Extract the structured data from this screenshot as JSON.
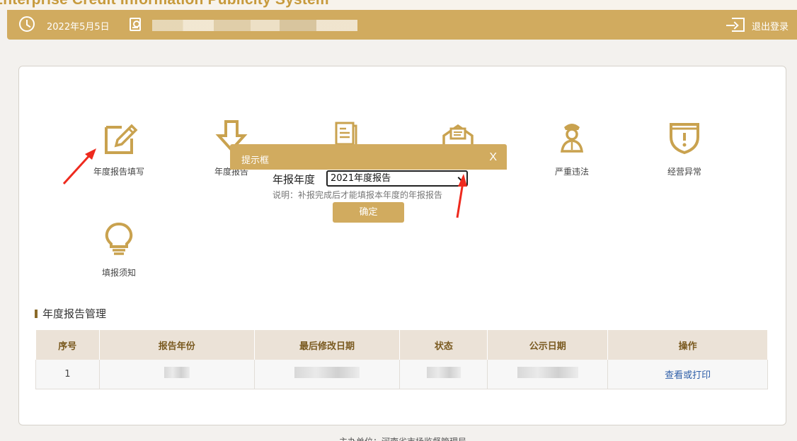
{
  "header": {
    "system_title": "Enterprise Credit Information Publicity System",
    "date": "2022年5月5日",
    "logout_label": "退出登录"
  },
  "functions": [
    {
      "label": "年度报告填写",
      "icon": "edit-icon"
    },
    {
      "label": "年度报告",
      "icon": "download-icon"
    },
    {
      "label": "",
      "icon": "document-icon"
    },
    {
      "label": "",
      "icon": "mail-icon"
    },
    {
      "label": "严重违法",
      "icon": "officer-icon"
    },
    {
      "label": "经营异常",
      "icon": "shield-alert-icon"
    },
    {
      "label": "填报须知",
      "icon": "lightbulb-icon"
    }
  ],
  "section": {
    "title": "年度报告管理"
  },
  "table": {
    "headers": [
      "序号",
      "报告年份",
      "最后修改日期",
      "状态",
      "公示日期",
      "操作"
    ],
    "rows": [
      {
        "index": "1",
        "action": "查看或打印"
      }
    ]
  },
  "dialog": {
    "title": "提示框",
    "close": "X",
    "year_label": "年报年度",
    "selected_year": "2021年度报告",
    "note": "说明：补报完成后才能填报本年度的年报报告",
    "confirm": "确定"
  },
  "footer": {
    "text": "主办单位：河南省市场监督管理局"
  },
  "colors": {
    "accent": "#d1ab5f",
    "header_text": "#ffffff",
    "table_header_bg": "#ebe2d7",
    "annotation_arrow": "#ee2a1e"
  }
}
